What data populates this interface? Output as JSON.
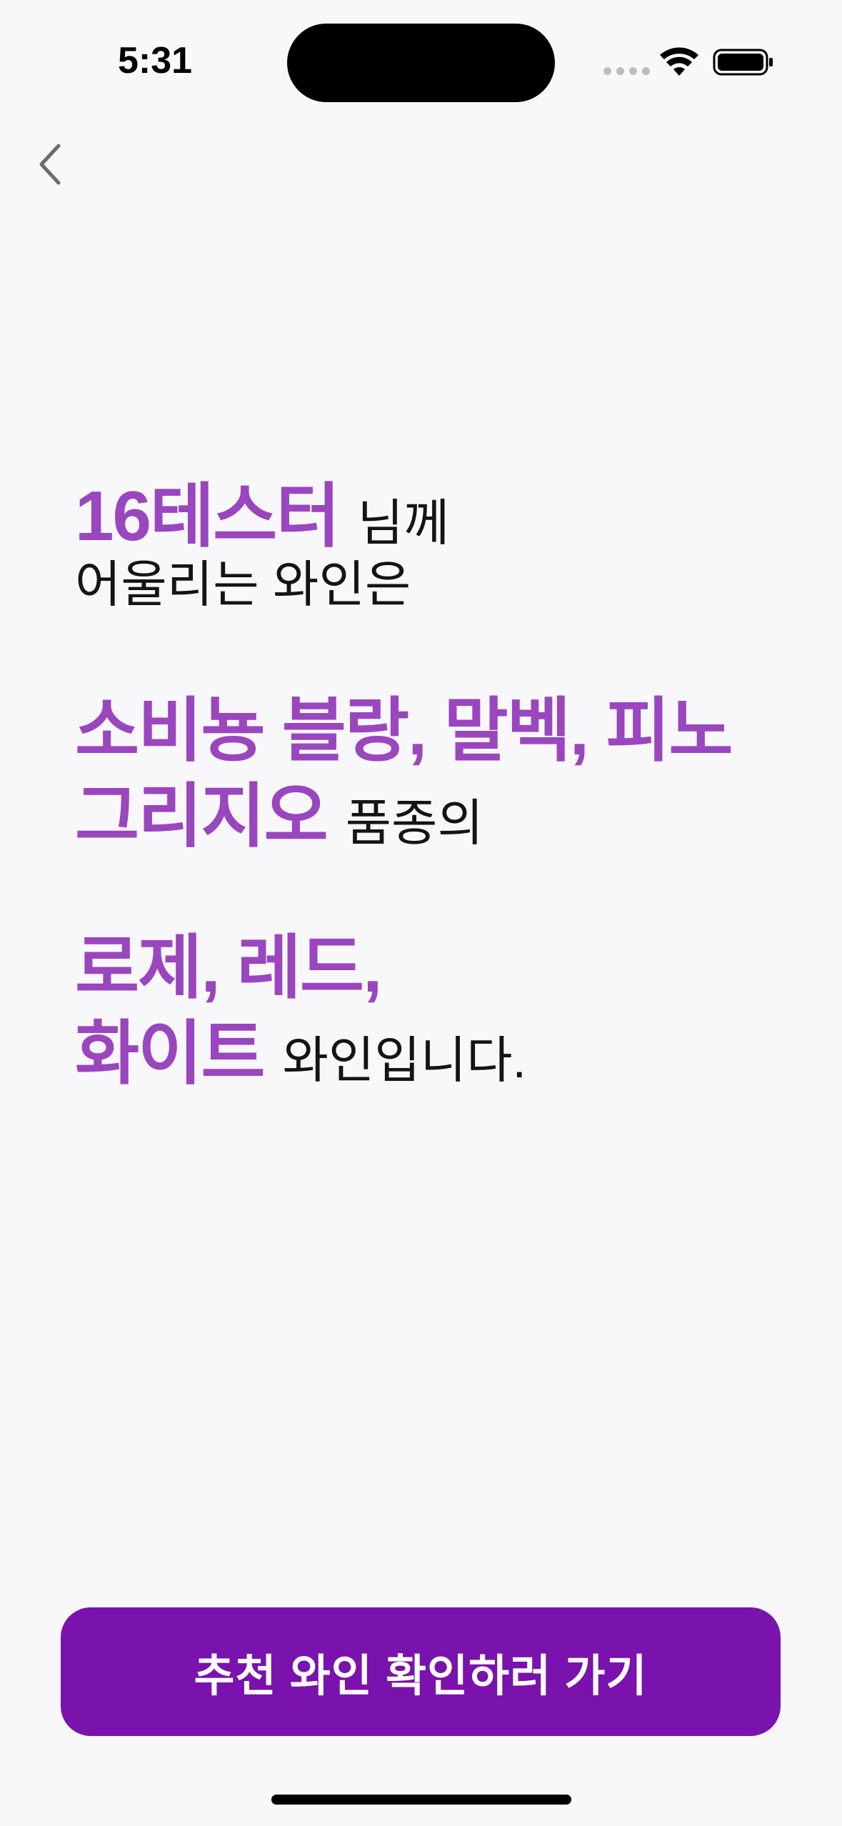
{
  "status_bar": {
    "time": "5:31",
    "icons": [
      "cellular-signal-icon",
      "wifi-icon",
      "battery-icon"
    ]
  },
  "nav": {
    "back_icon": "chevron-left-icon"
  },
  "result": {
    "user_name": "16테스터",
    "honorific": "님께",
    "line2": "어울리는 와인은",
    "varieties_line1": "소비뇽 블랑, 말벡, 피노",
    "varieties_line2": "그리지오",
    "varieties_suffix": "품종의",
    "types_line1": "로제, 레드,",
    "types_line2": "화이트",
    "types_suffix": "와인입니다."
  },
  "cta": {
    "label": "추천 와인 확인하러 가기"
  },
  "colors": {
    "highlight": "#9a46bf",
    "button": "#7a12ad",
    "background": "#f8f7fa"
  }
}
